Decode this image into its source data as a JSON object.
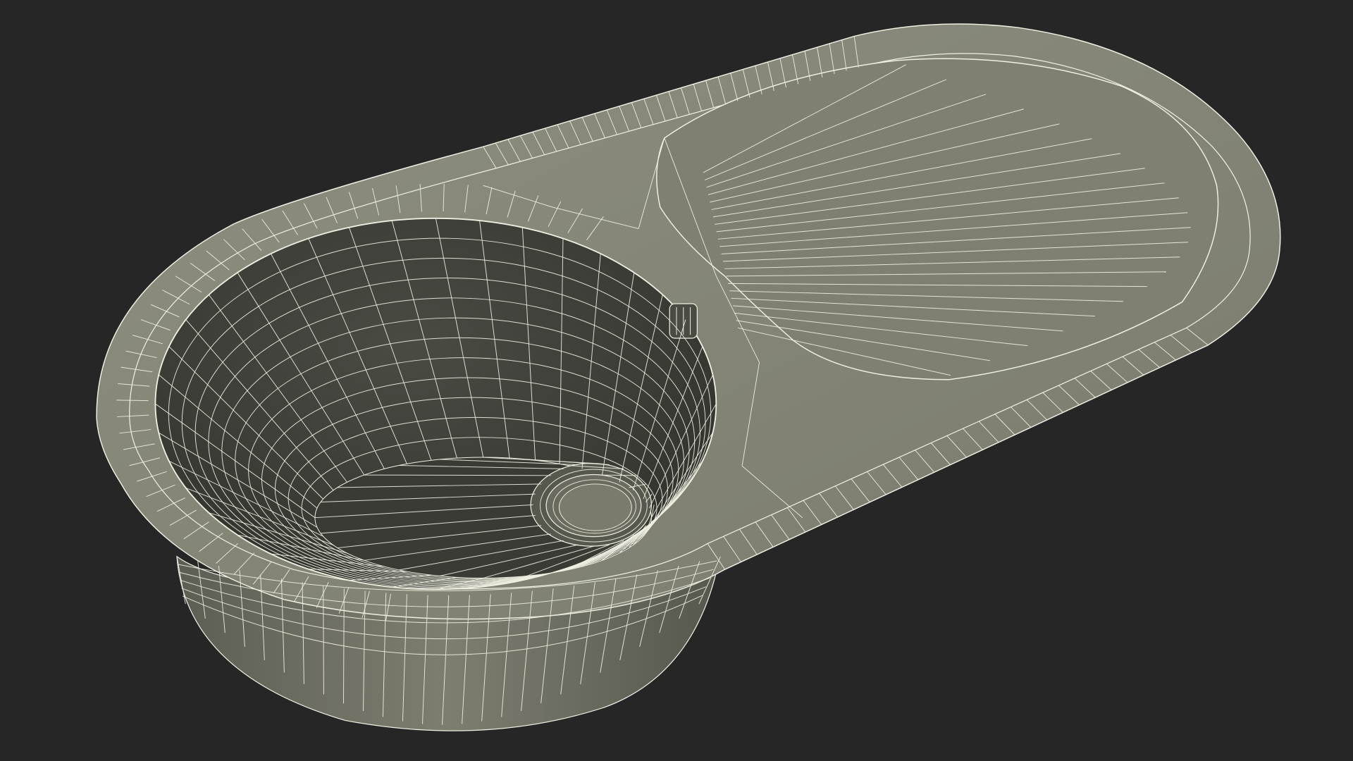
{
  "scene": {
    "background": "#262626",
    "render_mode": "wireframe-on-shaded",
    "colors": {
      "surface_light": "#8a8b7c",
      "surface_mid": "#757668",
      "surface_dark": "#4e4f46",
      "bowl_inner": "#3f403a",
      "wire": "#efefe2"
    }
  },
  "model": {
    "object": "kitchen-sink",
    "parts": [
      "rim",
      "round-bowl",
      "drainboard",
      "drain-strainer",
      "overflow-hole"
    ]
  }
}
